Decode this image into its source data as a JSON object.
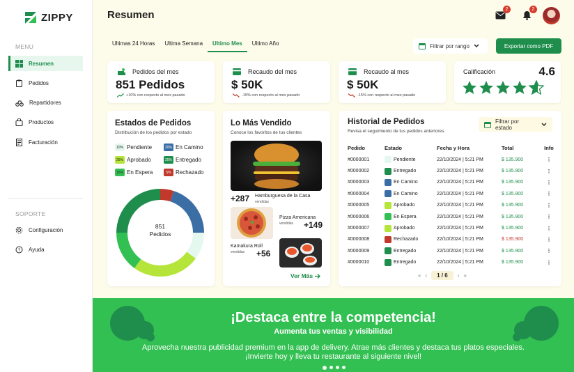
{
  "brand": {
    "name": "ZIPPY",
    "color": "#1f8e4d"
  },
  "sidebar": {
    "menu_heading": "MENU",
    "items": [
      {
        "label": "Resumen",
        "icon": "grid-icon",
        "active": true
      },
      {
        "label": "Pedidos",
        "icon": "clipboard-icon"
      },
      {
        "label": "Repartidores",
        "icon": "bike-icon"
      },
      {
        "label": "Productos",
        "icon": "bag-icon"
      },
      {
        "label": "Facturación",
        "icon": "invoice-icon"
      }
    ],
    "support_heading": "SOPORTE",
    "support_items": [
      {
        "label": "Configuración",
        "icon": "gear-icon"
      },
      {
        "label": "Ayuda",
        "icon": "help-icon"
      }
    ]
  },
  "header": {
    "title": "Resumen",
    "mail_badge": "2",
    "bell_badge": "2"
  },
  "tabs": [
    "Ultimas 24 Horas",
    "Ultima Semana",
    "Ultimo Mes",
    "Ultimo Año"
  ],
  "active_tab": "Ultimo Mes",
  "range_filter": "Filtrar por rango",
  "export_label": "Exportar como PDF",
  "kpis": [
    {
      "label": "Pedidos del mes",
      "value": "851 Pedidos",
      "note": "+10% con respecto al mes pasado",
      "trend": "up"
    },
    {
      "label": "Recaudo del mes",
      "value": "$ 50K",
      "note": "-15% con respecto al mes pasado",
      "trend": "down"
    },
    {
      "label": "Recaudo al mes",
      "value": "$ 50K",
      "note": "-15% con respecto al mes pasado",
      "trend": "down"
    }
  ],
  "rating": {
    "label": "Calificación",
    "value": "4.6",
    "stars": 4.6
  },
  "orders_status": {
    "title": "Estados de Pedidos",
    "subtitle": "Distribución de los pedidos por estado",
    "center_value": "851",
    "center_label": "Pedidos",
    "legend": [
      {
        "label": "Pendiente",
        "percent": "10%",
        "color": "#e4f8ef"
      },
      {
        "label": "En Camino",
        "percent": "20%",
        "color": "#3a6ea5"
      },
      {
        "label": "Aprobado",
        "percent": "25%",
        "color": "#b5e53b"
      },
      {
        "label": "Entregado",
        "percent": "25%",
        "color": "#1f8e4d"
      },
      {
        "label": "En Espera",
        "percent": "15%",
        "color": "#33c052"
      },
      {
        "label": "Rechazado",
        "percent": "5%",
        "color": "#c0392b"
      }
    ]
  },
  "best_sellers": {
    "title": "Lo Más Vendido",
    "subtitle": "Conoce los favoritos de tus clientes",
    "items": [
      {
        "name": "Hamburguesa de la Casa",
        "count": "+287",
        "note": "vendidas"
      },
      {
        "name": "Pizza Americana",
        "count": "+149",
        "note": "vendidas"
      },
      {
        "name": "Kamakura Roll",
        "count": "+56",
        "note": "vendidas"
      }
    ],
    "more_label": "Ver Más"
  },
  "history": {
    "title": "Historial de Pedidos",
    "subtitle": "Revisa el seguimiento de tus pedidos anteriores.",
    "filter_label": "Filtrar por estado",
    "columns": [
      "Pedido",
      "Estado",
      "Fecha y Hora",
      "Total",
      "Info"
    ],
    "rows": [
      {
        "id": "#0000001",
        "status": "Pendiente",
        "color": "#e4f8ef",
        "date": "22/10/2024 | 5:21 PM",
        "total": "$ 135.900",
        "total_color": "#1f8e4d"
      },
      {
        "id": "#0000002",
        "status": "Entregado",
        "color": "#1f8e4d",
        "date": "22/10/2024 | 5:21 PM",
        "total": "$ 135.900",
        "total_color": "#1f8e4d"
      },
      {
        "id": "#0000003",
        "status": "En Camino",
        "color": "#3a6ea5",
        "date": "22/10/2024 | 5:21 PM",
        "total": "$ 135.900",
        "total_color": "#1f8e4d"
      },
      {
        "id": "#0000004",
        "status": "En Camino",
        "color": "#3a6ea5",
        "date": "22/10/2024 | 5:21 PM",
        "total": "$ 135.900",
        "total_color": "#1f8e4d"
      },
      {
        "id": "#0000005",
        "status": "Aprobado",
        "color": "#b5e53b",
        "date": "22/10/2024 | 5:21 PM",
        "total": "$ 135.900",
        "total_color": "#1f8e4d"
      },
      {
        "id": "#0000006",
        "status": "En Espera",
        "color": "#33c052",
        "date": "22/10/2024 | 5:21 PM",
        "total": "$ 135.900",
        "total_color": "#1f8e4d"
      },
      {
        "id": "#0000007",
        "status": "Aprobado",
        "color": "#b5e53b",
        "date": "22/10/2024 | 5:21 PM",
        "total": "$ 135.900",
        "total_color": "#1f8e4d"
      },
      {
        "id": "#0000008",
        "status": "Rechazado",
        "color": "#c0392b",
        "date": "22/10/2024 | 5:21 PM",
        "total": "$ 135.900",
        "total_color": "#c0392b"
      },
      {
        "id": "#0000009",
        "status": "Entregado",
        "color": "#1f8e4d",
        "date": "22/10/2024 | 5:21 PM",
        "total": "$ 135.900",
        "total_color": "#1f8e4d"
      },
      {
        "id": "#0000010",
        "status": "Entregado",
        "color": "#1f8e4d",
        "date": "22/10/2024 | 5:21 PM",
        "total": "$ 135.900",
        "total_color": "#1f8e4d"
      }
    ],
    "pagination": "1 / 6"
  },
  "banner": {
    "title": "¡Destaca entre la competencia!",
    "subtitle": "Aumenta tus ventas y visibilidad",
    "text_line1": "Aprovecha nuestra publicidad premium en la app de delivery. Atrae más clientes y destaca tus platos especiales.",
    "text_line2": "¡Invierte hoy y lleva tu restaurante al siguiente nivel!",
    "slides": 4,
    "active_slide": 0
  },
  "chart_data": {
    "type": "pie",
    "categories": [
      "Pendiente",
      "En Camino",
      "Aprobado",
      "Entregado",
      "En Espera",
      "Rechazado"
    ],
    "values": [
      10,
      20,
      25,
      25,
      15,
      5
    ],
    "colors": [
      "#e4f8ef",
      "#3a6ea5",
      "#b5e53b",
      "#1f8e4d",
      "#33c052",
      "#c0392b"
    ],
    "title": "Estados de Pedidos"
  }
}
